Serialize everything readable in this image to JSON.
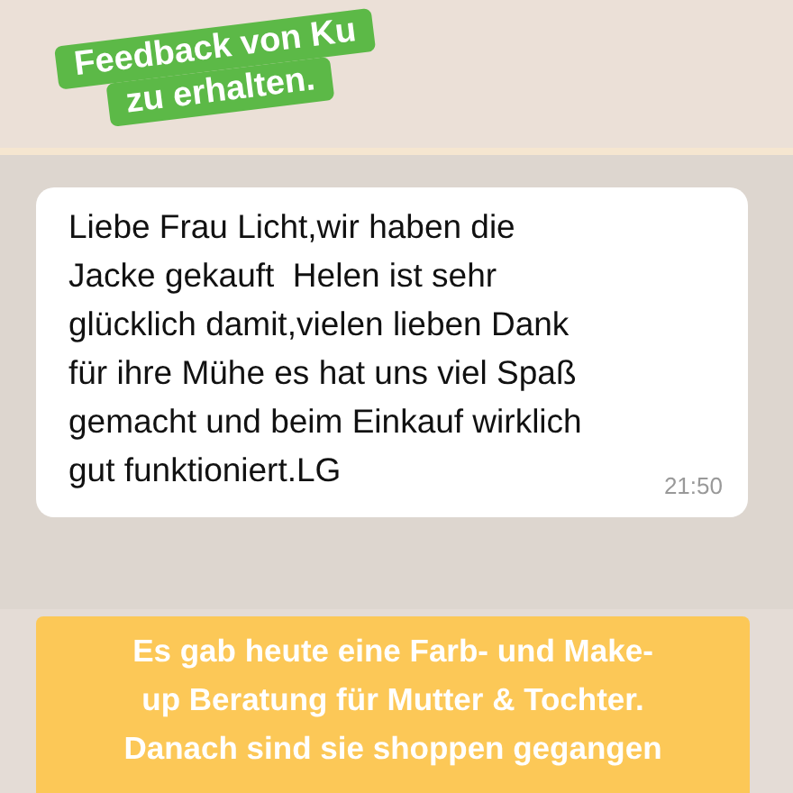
{
  "sticker_top": {
    "lines": [
      "Feedback von Ku",
      "zu erhalten."
    ]
  },
  "message": {
    "lines": [
      "Liebe Frau Licht,wir haben die",
      "Jacke gekauft  Helen ist sehr",
      "glücklich damit,vielen lieben Dank",
      "für ihre Mühe es hat uns viel Spaß",
      "gemacht und beim Einkauf wirklich",
      "gut funktioniert.LG"
    ],
    "time": "21:50"
  },
  "caption": {
    "lines": [
      "Es gab heute eine Farb- und Make-",
      "up Beratung für Mutter & Tochter.",
      "Danach sind sie shoppen gegangen"
    ]
  }
}
